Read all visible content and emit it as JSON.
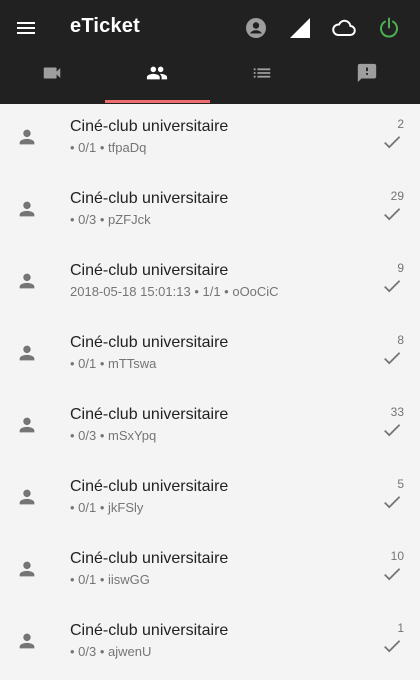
{
  "app": {
    "title": "eTicket"
  },
  "toolbar": {
    "icons": [
      "menu-icon",
      "account-circle-icon",
      "signal-icon",
      "cloud-icon",
      "power-icon"
    ],
    "power_color": "#4caf50"
  },
  "tabs": [
    {
      "icon": "videocam-icon",
      "active": false
    },
    {
      "icon": "people-icon",
      "active": true
    },
    {
      "icon": "list-icon",
      "active": false
    },
    {
      "icon": "feedback-icon",
      "active": false
    }
  ],
  "accent": "#ef6c6c",
  "rows": [
    {
      "title": "Ciné-club universitaire",
      "subtitle": " • 0/1 • tfpaDq",
      "count": "2"
    },
    {
      "title": "Ciné-club universitaire",
      "subtitle": " • 0/3 • pZFJck",
      "count": "29"
    },
    {
      "title": "Ciné-club universitaire",
      "subtitle": "2018-05-18 15:01:13 • 1/1 • oOoCiC",
      "count": "9"
    },
    {
      "title": "Ciné-club universitaire",
      "subtitle": " • 0/1 • mTTswa",
      "count": "8"
    },
    {
      "title": "Ciné-club universitaire",
      "subtitle": " • 0/3 • mSxYpq",
      "count": "33"
    },
    {
      "title": "Ciné-club universitaire",
      "subtitle": " • 0/1 • jkFSly",
      "count": "5"
    },
    {
      "title": "Ciné-club universitaire",
      "subtitle": " • 0/1 • iiswGG",
      "count": "10"
    },
    {
      "title": "Ciné-club universitaire",
      "subtitle": " • 0/3 • ajwenU",
      "count": "1"
    }
  ]
}
